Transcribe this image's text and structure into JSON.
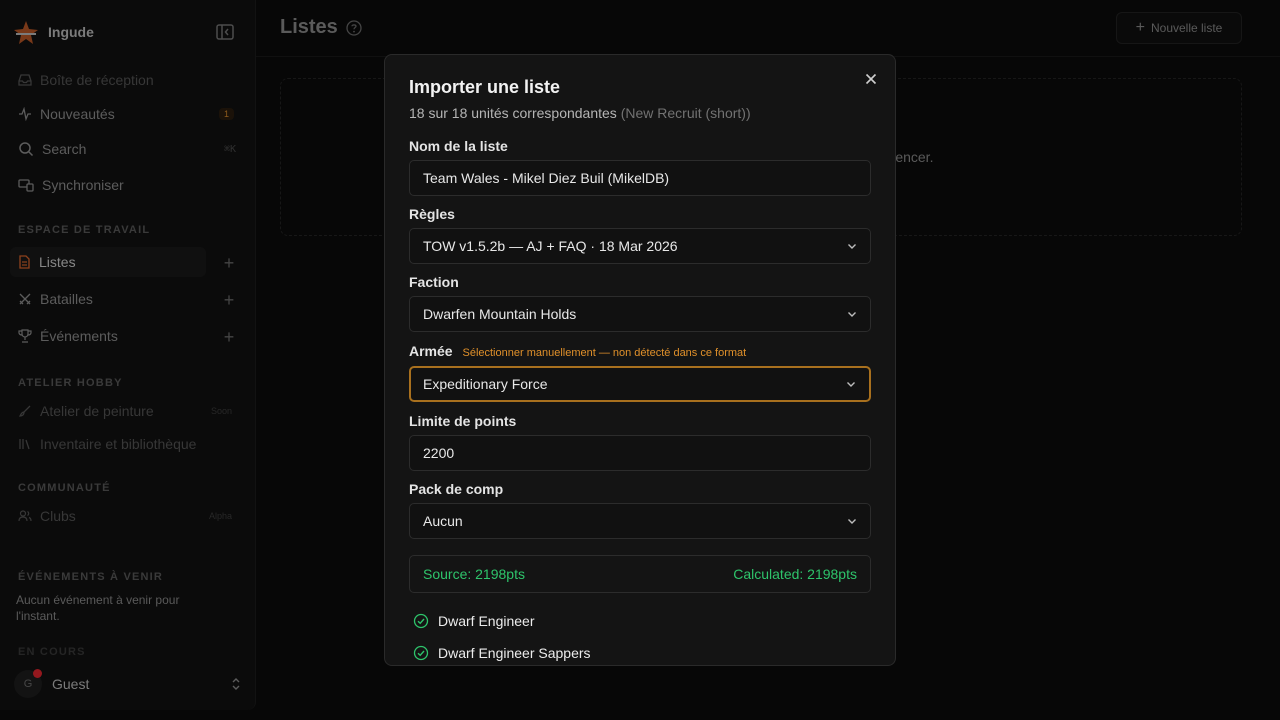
{
  "sidebar": {
    "brand": "Ingude",
    "items": [
      {
        "label": "Boîte de réception"
      },
      {
        "label": "Nouveautés",
        "badge": "1"
      },
      {
        "label": "Search",
        "shortcut": "⌘K"
      },
      {
        "label": "Synchroniser"
      }
    ],
    "workspace": {
      "title": "ESPACE DE TRAVAIL",
      "items": [
        {
          "label": "Listes"
        },
        {
          "label": "Batailles"
        },
        {
          "label": "Événements"
        }
      ]
    },
    "hobby": {
      "title": "ATELIER HOBBY",
      "items": [
        {
          "label": "Atelier de peinture",
          "tag": "Soon"
        },
        {
          "label": "Inventaire et bibliothèque"
        }
      ]
    },
    "community": {
      "title": "COMMUNAUTÉ",
      "items": [
        {
          "label": "Clubs",
          "tag": "Alpha"
        }
      ]
    },
    "upcoming": {
      "title": "ÉVÉNEMENTS À VENIR",
      "text": "Aucun événement à venir pour l'instant."
    },
    "ongoing_title": "EN COURS",
    "user": {
      "initial": "G",
      "name": "Guest"
    }
  },
  "main": {
    "title": "Listes",
    "new_button": "Nouvelle liste",
    "empty_text": "mmencer."
  },
  "modal": {
    "title": "Importer une liste",
    "subtitle": "18 sur 18 unités correspondantes",
    "subtitle_source": "(New Recruit (short))",
    "fields": {
      "name": {
        "label": "Nom de la liste",
        "value": "Team Wales - Mikel Diez Buil (MikelDB)"
      },
      "rules": {
        "label": "Règles",
        "value": "TOW v1.5.2b — AJ + FAQ · 18 Mar 2026"
      },
      "faction": {
        "label": "Faction",
        "value": "Dwarfen Mountain Holds"
      },
      "army": {
        "label": "Armée",
        "warning": "Sélectionner manuellement — non détecté dans ce format",
        "value": "Expeditionary Force"
      },
      "points": {
        "label": "Limite de points",
        "value": "2200"
      },
      "comp": {
        "label": "Pack de comp",
        "value": "Aucun"
      }
    },
    "points_summary": {
      "source": "Source: 2198pts",
      "calculated": "Calculated: 2198pts"
    },
    "units": [
      "Dwarf Engineer",
      "Dwarf Engineer Sappers"
    ]
  },
  "colors": {
    "accent": "#e0902a",
    "success": "#2ec46b",
    "alert": "#e3252f"
  }
}
